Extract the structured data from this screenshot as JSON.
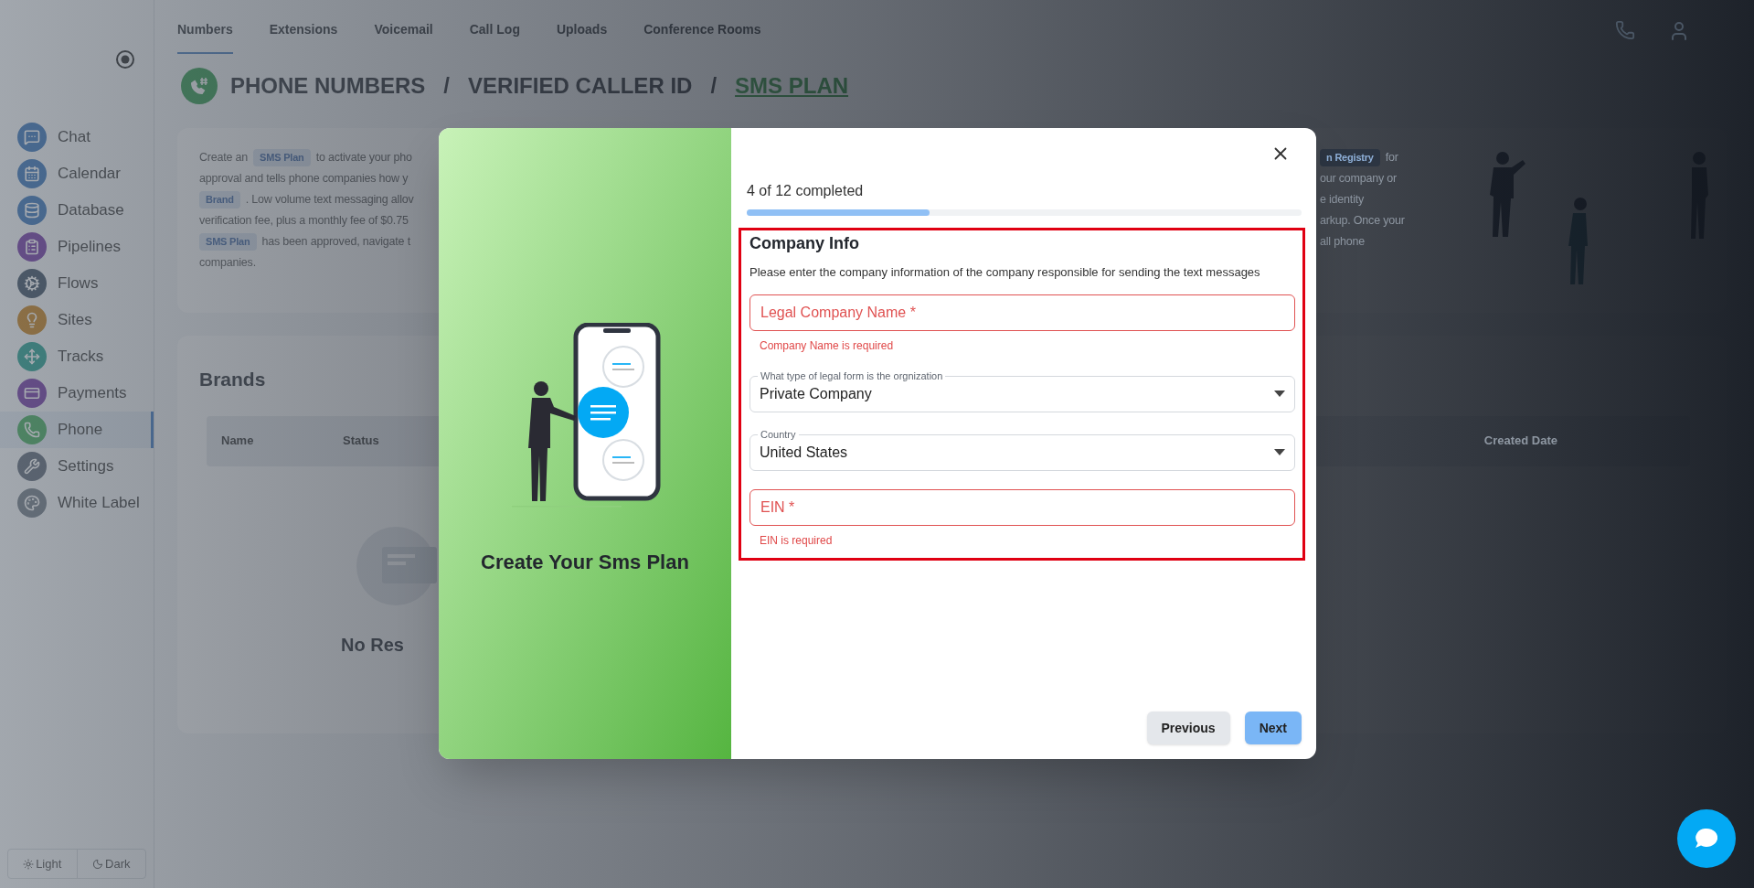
{
  "sidebar": {
    "items": [
      {
        "label": "Chat",
        "selected": false
      },
      {
        "label": "Calendar",
        "selected": false
      },
      {
        "label": "Database",
        "selected": false
      },
      {
        "label": "Pipelines",
        "selected": false
      },
      {
        "label": "Flows",
        "selected": false
      },
      {
        "label": "Sites",
        "selected": false
      },
      {
        "label": "Tracks",
        "selected": false
      },
      {
        "label": "Payments",
        "selected": false
      },
      {
        "label": "Phone",
        "selected": true
      },
      {
        "label": "Settings",
        "selected": false
      },
      {
        "label": "White Label",
        "selected": false
      }
    ],
    "theme_toggle": [
      {
        "label": "Light",
        "kind": "sun"
      },
      {
        "label": "Dark",
        "kind": "moon"
      }
    ]
  },
  "tabs": [
    {
      "label": "Numbers",
      "selected": true
    },
    {
      "label": "Extensions",
      "selected": false
    },
    {
      "label": "Voicemail",
      "selected": false
    },
    {
      "label": "Call Log",
      "selected": false
    },
    {
      "label": "Uploads",
      "selected": false
    },
    {
      "label": "Conference Rooms",
      "selected": false
    }
  ],
  "breadcrumb": [
    {
      "kind": "crumb",
      "label": "PHONE NUMBERS",
      "selected": false
    },
    {
      "kind": "separator",
      "label": "/"
    },
    {
      "kind": "crumb",
      "label": "VERIFIED CALLER ID",
      "selected": false
    },
    {
      "kind": "separator",
      "label": "/"
    },
    {
      "kind": "crumb",
      "label": "SMS PLAN",
      "selected": true
    }
  ],
  "info": {
    "left_lines": [
      [
        {
          "kind": "text",
          "text": "Create an"
        },
        {
          "kind": "tag",
          "text": "SMS Plan"
        },
        {
          "kind": "text",
          "text": "to activate your pho"
        }
      ],
      [
        {
          "kind": "text",
          "text": "approval and tells phone companies how y"
        }
      ],
      [
        {
          "kind": "tag",
          "text": "Brand"
        },
        {
          "kind": "text",
          "text": ". Low volume text messaging allov"
        }
      ],
      [
        {
          "kind": "text",
          "text": "verification fee, plus a monthly fee of $0.75"
        }
      ],
      [
        {
          "kind": "tag",
          "text": "SMS Plan"
        },
        {
          "kind": "text",
          "text": "has been approved, navigate t"
        }
      ],
      [
        {
          "kind": "text",
          "text": "companies."
        }
      ]
    ],
    "right_lines": [
      [
        {
          "kind": "tag",
          "text": "n Registry"
        },
        {
          "kind": "text",
          "text": "for"
        }
      ],
      [
        {
          "kind": "text",
          "text": "our company or"
        }
      ],
      [
        {
          "kind": "text",
          "text": "e identity"
        }
      ],
      [
        {
          "kind": "text",
          "text": "arkup. Once your"
        }
      ],
      [
        {
          "kind": "text",
          "text": "all phone"
        }
      ]
    ]
  },
  "brands": {
    "title": "Brands",
    "columns": [
      "Name",
      "Status",
      "Created Date"
    ],
    "empty_text": "No Res"
  },
  "modal": {
    "title": "Create Your Sms Plan",
    "progress_text": "4 of 12 completed",
    "progress": {
      "level": 0.33
    },
    "section": {
      "highlighted": true,
      "title": "Company Info",
      "description": "Please enter the company information of the company responsible for sending the text messages",
      "fields": [
        {
          "kind": "text",
          "placeholder": "Legal Company Name *",
          "invalid": true,
          "error": "Company Name is required"
        },
        {
          "kind": "select",
          "label": "What type of legal form is the orgnization",
          "value": "Private Company"
        },
        {
          "kind": "select",
          "label": "Country",
          "value": "United States"
        },
        {
          "kind": "text",
          "placeholder": "EIN *",
          "invalid": true,
          "error": "EIN is required"
        }
      ]
    },
    "buttons": [
      {
        "label": "Previous",
        "kind": "secondary"
      },
      {
        "label": "Next",
        "kind": "primary"
      }
    ]
  }
}
